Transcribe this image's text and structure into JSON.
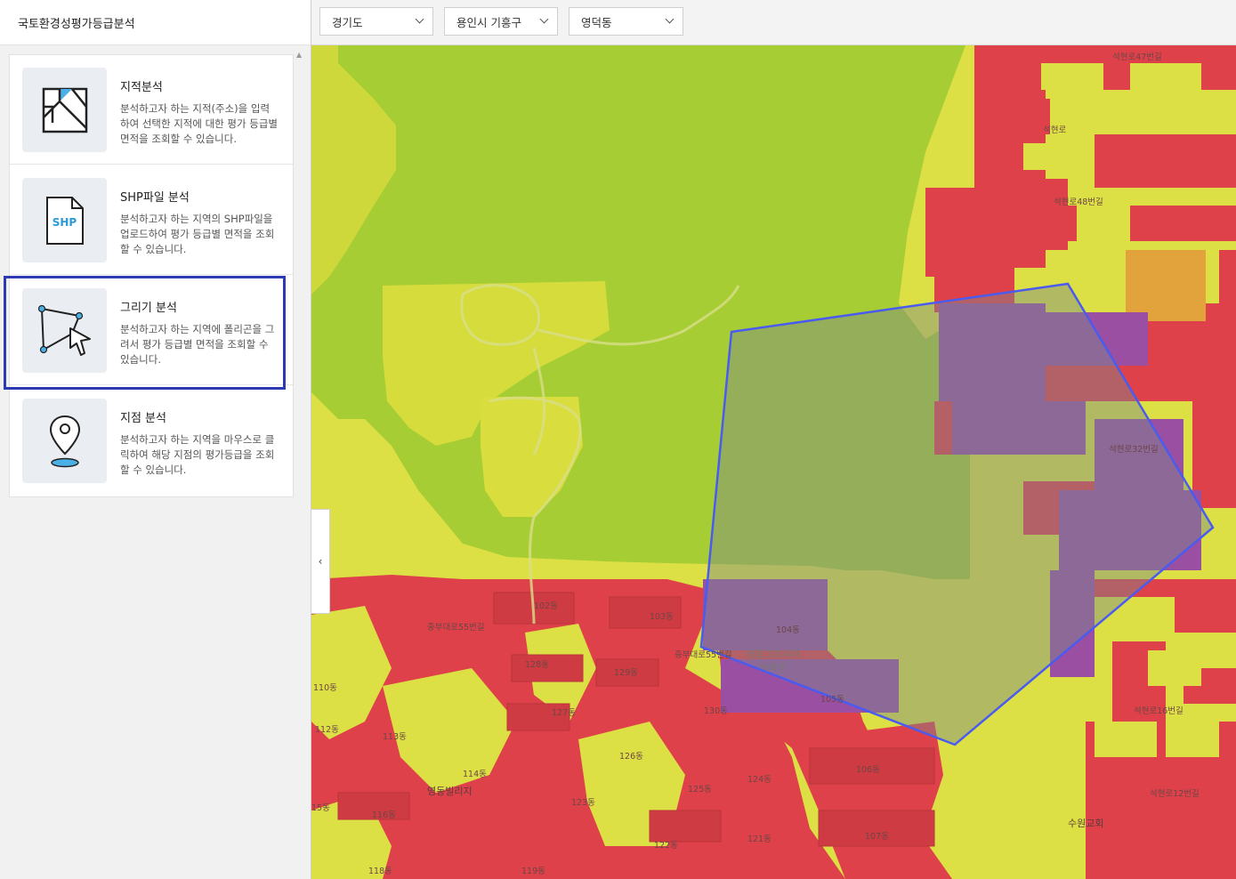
{
  "app": {
    "title": "국토환경성평가등급분석"
  },
  "filters": [
    {
      "label": "경기도"
    },
    {
      "label": "용인시 기흥구"
    },
    {
      "label": "영덕동"
    }
  ],
  "analysis_modes": [
    {
      "title": "지적분석",
      "description": "분석하고자 하는 지적(주소)을 입력하여 선택한 지적에 대한 평가 등급별 면적을 조회할 수 있습니다.",
      "icon": "cadastral-map-icon"
    },
    {
      "title": "SHP파일 분석",
      "description": "분석하고자 하는 지역의 SHP파일을 업로드하여 평가 등급별 면적을 조회 할 수 있습니다.",
      "icon": "shp-file-icon",
      "icon_text": "SHP"
    },
    {
      "title": "그리기 분석",
      "description": "분석하고자 하는 지역에 폴리곤을 그려서 평가 등급별 면적을 조회할 수 있습니다.",
      "icon": "polygon-draw-icon",
      "selected": true
    },
    {
      "title": "지점 분석",
      "description": "분석하고자 하는 지역을 마우스로 클릭하여 해당 지점의 평가등급을 조회할 수 있습니다.",
      "icon": "location-pin-icon"
    }
  ],
  "map": {
    "collapse_label": "‹",
    "grade_colors": {
      "grade1_green": "#a7cd34",
      "grade2_yellow": "#dde044",
      "grade3_orange": "#e3a33c",
      "grade5_red": "#de4149",
      "selection_purple": "#9a4fa2",
      "polygon_stroke": "#4a5bf0"
    },
    "labels": {
      "l1": "석현로47번길",
      "l2": "석현로",
      "l3": "석현로48번길",
      "l4": "석현로32번길",
      "l5": "석현로16번길",
      "l6": "석현로12번길",
      "l7": "수원교회",
      "l8": "중부대로55번길",
      "l9": "중부대로55번길",
      "l10": "102동",
      "l11": "103동",
      "l12": "104동",
      "l13": "105동",
      "l14": "106동",
      "l15": "107동",
      "l16": "128동",
      "l17": "129동",
      "l18": "127동",
      "l19": "130동",
      "l20": "126동",
      "l21": "125동",
      "l22": "124동",
      "l23": "123동",
      "l24": "122동",
      "l25": "121동",
      "l26": "119동",
      "l27": "118동",
      "l28": "116동",
      "l29": "114동",
      "l30": "113동",
      "l31": "112동",
      "l32": "110동",
      "l33": "15동",
      "l34": "세종그라시아",
      "l35": "아파트",
      "l36": "영동빌리지",
      "l37": "석현로",
      "l38": "석현로",
      "l39": "석현로"
    }
  }
}
